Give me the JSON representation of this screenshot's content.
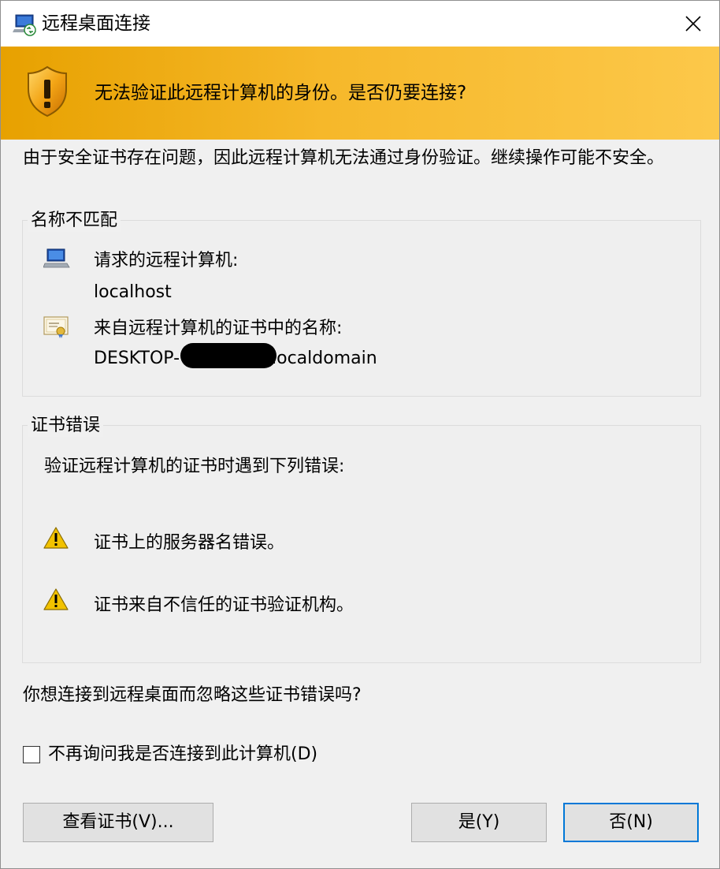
{
  "window": {
    "title": "远程桌面连接",
    "title_icon": "remote-desktop-icon",
    "close_icon": "close-icon"
  },
  "banner": {
    "text": "无法验证此远程计算机的身份。是否仍要连接?",
    "icon": "security-shield-warning-icon",
    "color": "#f6b82a"
  },
  "intro_text": "由于安全证书存在问题，因此远程计算机无法通过身份验证。继续操作可能不安全。",
  "name_mismatch": {
    "legend": "名称不匹配",
    "requested_label": "请求的远程计算机:",
    "requested_value": "localhost",
    "cert_name_label": "来自远程计算机的证书中的名称:",
    "cert_name_prefix": "DESKTOP-",
    "cert_name_suffix": ".localdomain"
  },
  "cert_errors": {
    "legend": "证书错误",
    "intro": "验证远程计算机的证书时遇到下列错误:",
    "errors": [
      "证书上的服务器名错误。",
      "证书来自不信任的证书验证机构。"
    ]
  },
  "question": "你想连接到远程桌面而忽略这些证书错误吗?",
  "checkbox": {
    "label": "不再询问我是否连接到此计算机(D)",
    "checked": false
  },
  "buttons": {
    "view_cert": "查看证书(V)...",
    "yes": "是(Y)",
    "no": "否(N)"
  },
  "colors": {
    "accent_focus": "#0078d7",
    "warning": "#f2c200"
  }
}
